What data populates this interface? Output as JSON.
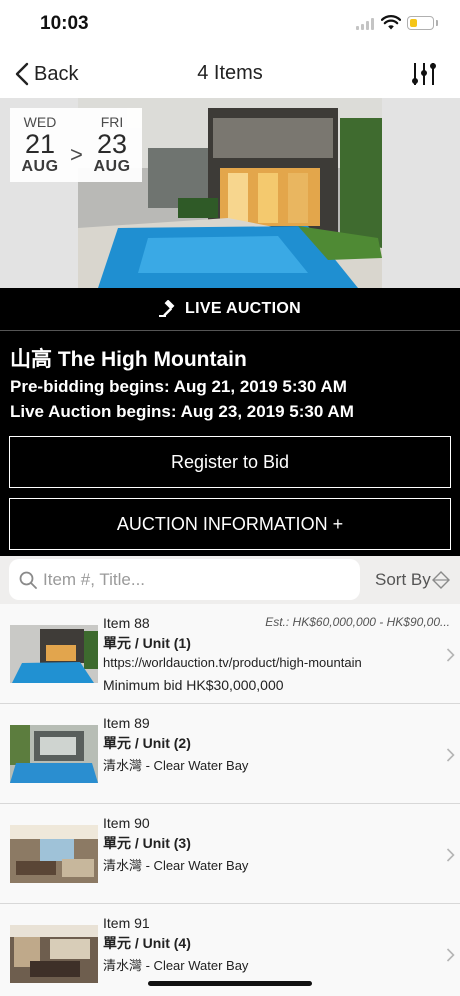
{
  "status_bar": {
    "time": "10:03"
  },
  "nav": {
    "back_label": "Back",
    "title": "4 Items",
    "filter_icon": "sliders-icon"
  },
  "hero": {
    "start": {
      "dow": "WED",
      "day": "21",
      "month": "AUG"
    },
    "separator": ">",
    "end": {
      "dow": "FRI",
      "day": "23",
      "month": "AUG"
    }
  },
  "auction": {
    "live_label": "LIVE AUCTION",
    "title": "山高 The High Mountain",
    "prebid": "Pre-bidding begins: Aug 21, 2019 5:30 AM",
    "live": "Live Auction begins: Aug 23, 2019 5:30 AM",
    "register_label": "Register to Bid",
    "info_label": "AUCTION INFORMATION +"
  },
  "search": {
    "placeholder": "Item #, Title...",
    "sort_label": "Sort By"
  },
  "items": [
    {
      "number": "Item 88",
      "estimate": "Est.: HK$60,000,000 - HK$90,00...",
      "title": "單元 / Unit (1)",
      "line3": "https://worldauction.tv/product/high-mountain",
      "line4": "Minimum bid HK$30,000,000"
    },
    {
      "number": "Item 89",
      "title": "單元 / Unit (2)",
      "line3": "清水灣 - Clear Water Bay"
    },
    {
      "number": "Item 90",
      "title": "單元 / Unit (3)",
      "line3": "清水灣 - Clear Water Bay"
    },
    {
      "number": "Item 91",
      "title": "單元 / Unit (4)",
      "line3": "清水灣 - Clear Water Bay"
    }
  ]
}
